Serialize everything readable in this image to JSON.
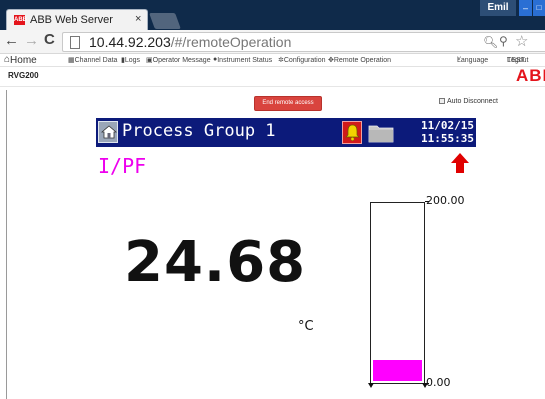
{
  "browser": {
    "tab_title": "ABB Web Server",
    "tab_logo": "ABB",
    "close_glyph": "×",
    "user": "Emil",
    "url_host": "10.44.92.203",
    "url_path": "/#/remoteOperation"
  },
  "nav": {
    "home": "Home",
    "items": [
      "Channel Data",
      "Logs",
      "Operator Message",
      "Instrument Status",
      "Configuration",
      "Remote Operation"
    ],
    "language": "Language",
    "logout": "Logout",
    "user": "TEST"
  },
  "page": {
    "device_name": "RVG200",
    "logo": "ABB",
    "end_button": "End remote access",
    "auto_disconnect": "Auto Disconnect"
  },
  "device": {
    "group_name": "Process Group 1",
    "date": "11/02/15",
    "time": "11:55:35",
    "channel_tag": "I/PF",
    "value": "24.68",
    "unit": "°C",
    "bar_max": "200.00",
    "bar_min": "0.00",
    "bar_level_fraction": 0.12,
    "colors": {
      "title_bar": "#0c1a7a",
      "channel": "#ee00ee",
      "bar_fill": "#ff00ff",
      "trend_arrow": "#e00000",
      "alarm": "#d11a1a"
    },
    "trend": "up-arrow-icon"
  }
}
